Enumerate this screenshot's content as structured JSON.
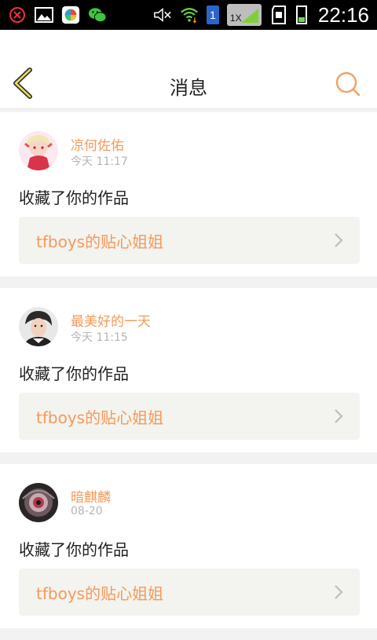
{
  "status_bar": {
    "time": "22:16",
    "sim_badge": "1",
    "speed_badge": "1X",
    "icons": [
      "close-circle-icon",
      "image-icon",
      "app-icon",
      "wechat-icon",
      "mute-icon",
      "wifi-icon",
      "sim-icon",
      "signal-icon",
      "sd-card-icon",
      "battery-icon"
    ],
    "colors": {
      "background": "#000000",
      "wechat": "#3fc43f",
      "battery": "#76d05b"
    }
  },
  "header": {
    "title": "消息",
    "back_icon": "chevron-left-icon",
    "search_icon": "search-icon",
    "accent": "#f0a36a"
  },
  "messages": [
    {
      "user": "凉何佐佑",
      "time": "今天 11:17",
      "action": "收藏了你的作品",
      "work": "tfboys的贴心姐姐",
      "avatar": "anime-girl-avatar"
    },
    {
      "user": "最美好的一天",
      "time": "今天 11:15",
      "action": "收藏了你的作品",
      "work": "tfboys的贴心姐姐",
      "avatar": "boy-avatar"
    },
    {
      "user": "暗麒麟",
      "time": "08-20",
      "action": "收藏了你的作品",
      "work": "tfboys的贴心姐姐",
      "avatar": "eye-avatar"
    }
  ],
  "colors": {
    "accent": "#f39a5b",
    "muted": "#b5b5b5",
    "work_bg": "#f3f3ef"
  }
}
